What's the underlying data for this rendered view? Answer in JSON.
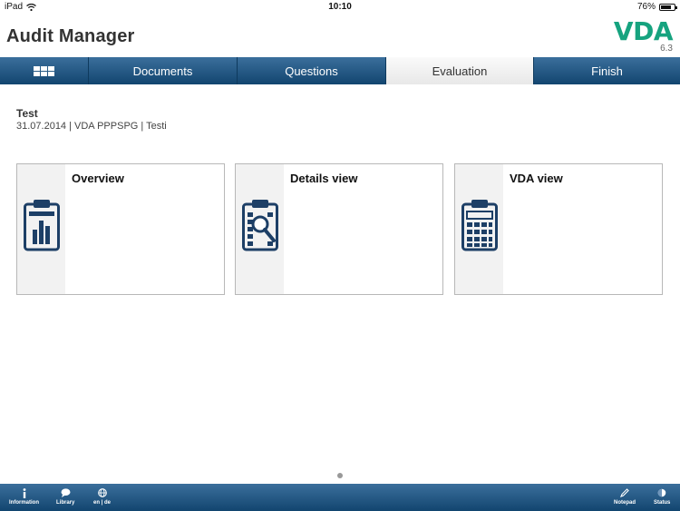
{
  "status": {
    "device": "iPad",
    "wifi_icon": "wifi-icon",
    "time": "10:10",
    "battery": "76%",
    "battery_level": 0.76
  },
  "header": {
    "title": "Audit Manager",
    "logo": "VDA",
    "version": "6.3"
  },
  "tabs": {
    "home_icon": "grid-icon",
    "documents": "Documents",
    "questions": "Questions",
    "evaluation": "Evaluation",
    "finish": "Finish",
    "active": "Evaluation"
  },
  "document": {
    "title": "Test",
    "meta": "31.07.2014 | VDA PPPSPG | Testi"
  },
  "cards": [
    {
      "label": "Overview",
      "icon": "clipboard-bar-chart-icon"
    },
    {
      "label": "Details view",
      "icon": "clipboard-magnifier-icon"
    },
    {
      "label": "VDA view",
      "icon": "calculator-icon"
    }
  ],
  "colors": {
    "bar_blue": "#1c4f7c",
    "logo_green": "#16a37f",
    "icon_blue": "#1d3f66"
  },
  "bottombar": {
    "information": "Information",
    "library": "Library",
    "language": "en | de",
    "notepad": "Notepad",
    "status": "Status"
  }
}
